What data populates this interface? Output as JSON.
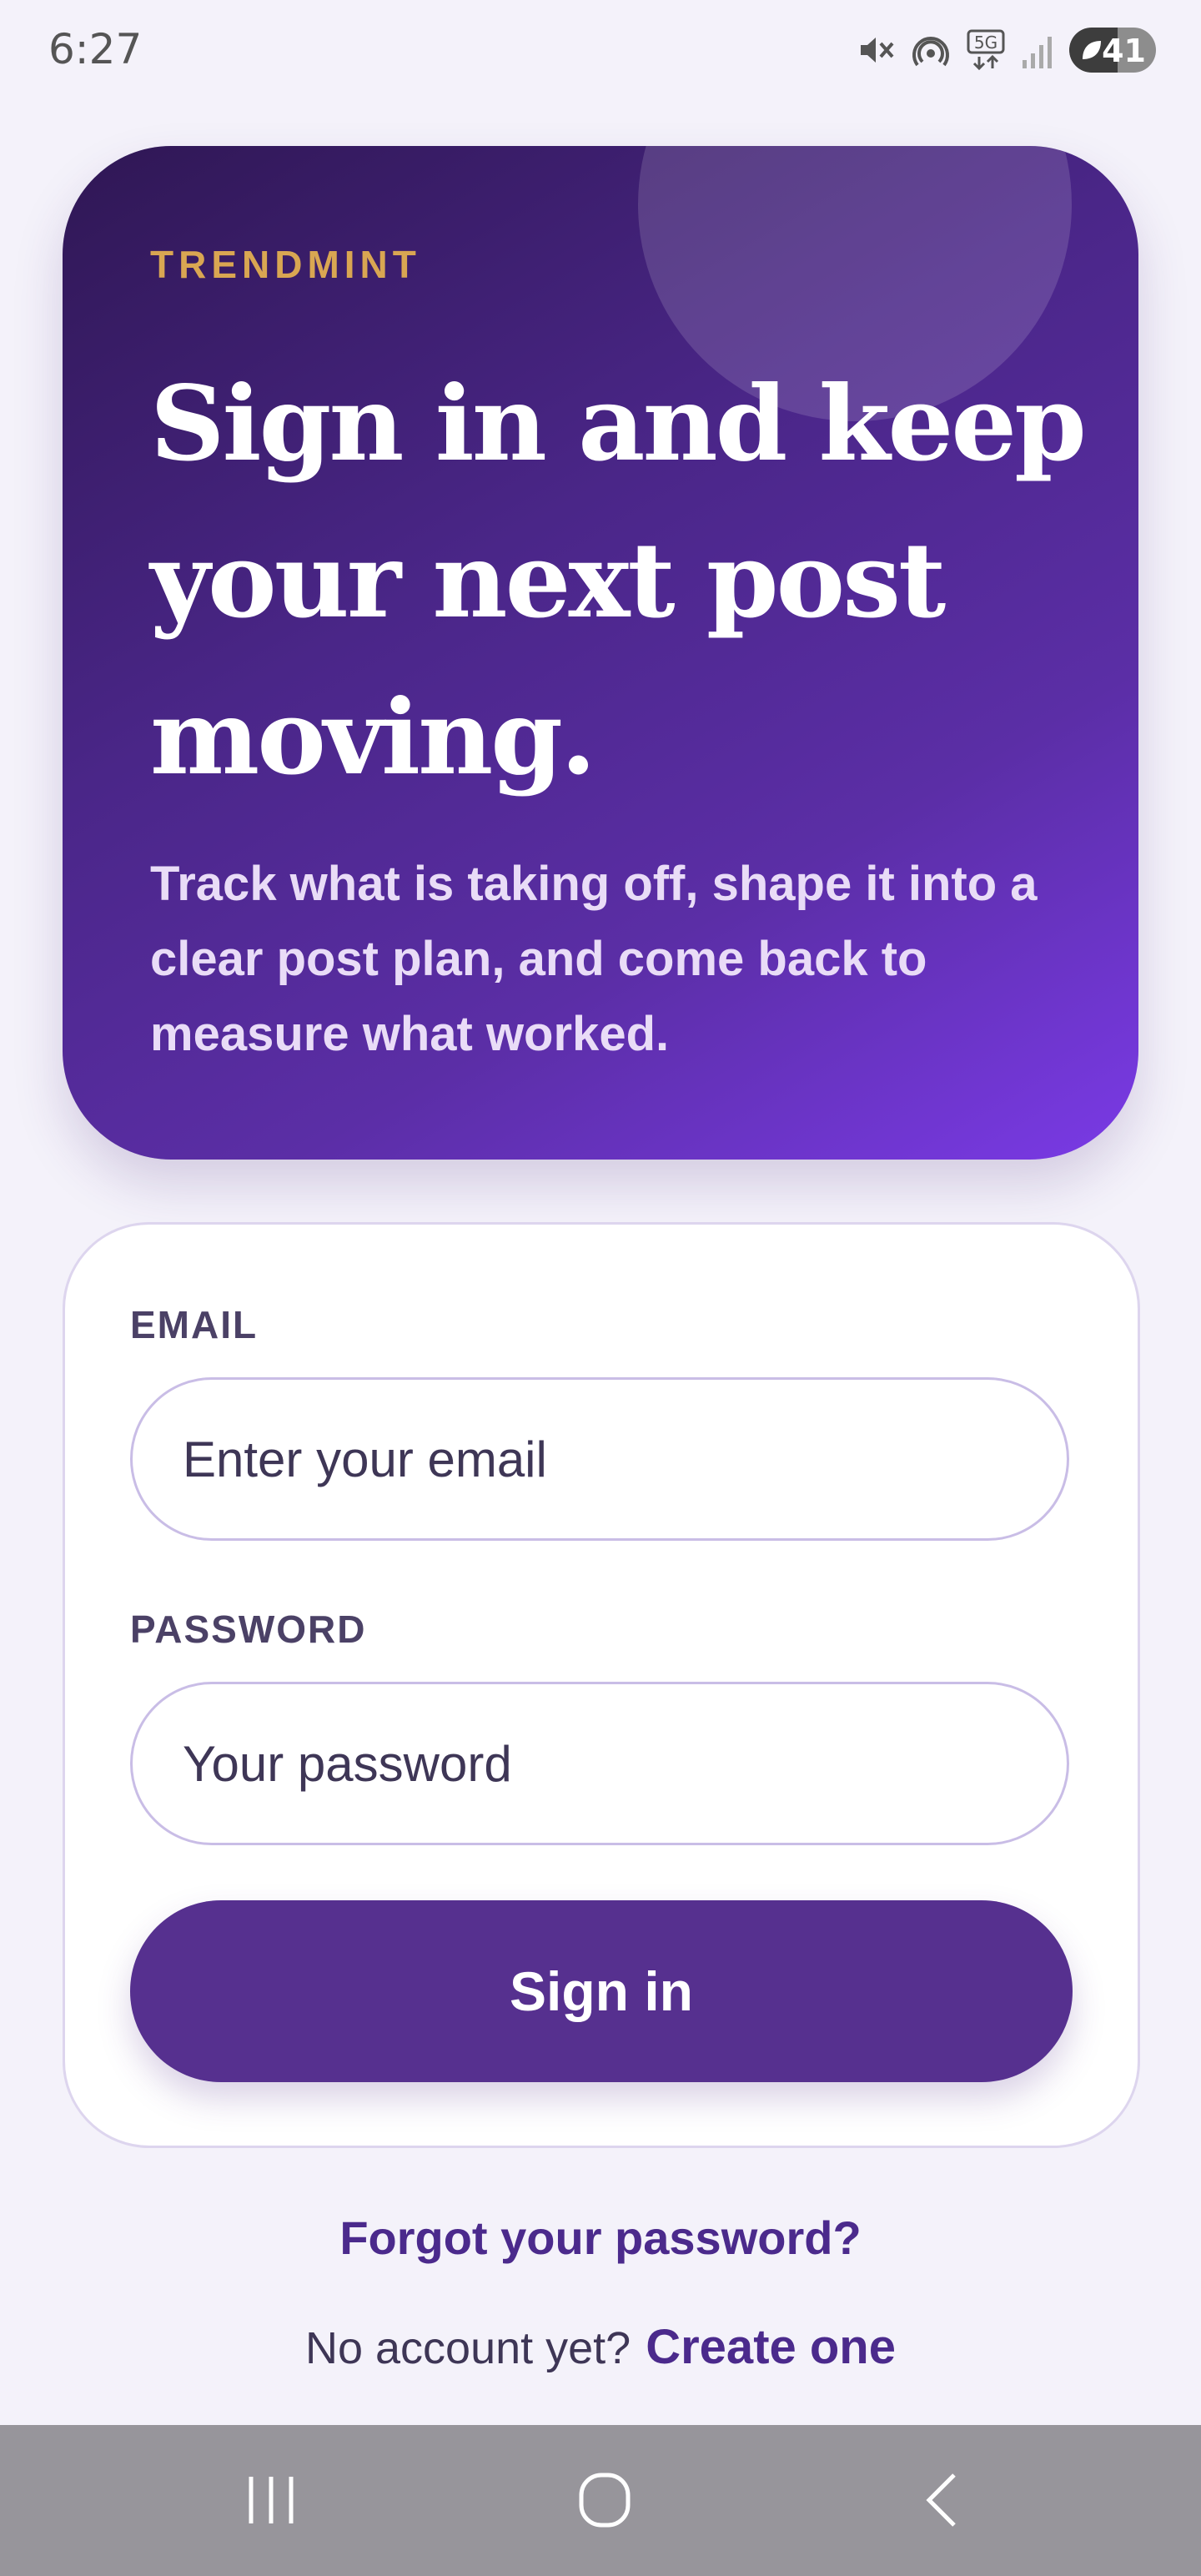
{
  "status_bar": {
    "time": "6:27",
    "battery_level": "41",
    "network": "5G"
  },
  "hero": {
    "brand": "TRENDMINT",
    "title": "Sign in and keep your next post moving.",
    "subtitle": "Track what is taking off, shape it into a clear post plan, and come back to measure what worked."
  },
  "form": {
    "email_label": "EMAIL",
    "email_placeholder": "Enter your email",
    "email_value": "",
    "password_label": "PASSWORD",
    "password_placeholder": "Your password",
    "password_value": "",
    "submit_label": "Sign in"
  },
  "footer": {
    "forgot_label": "Forgot your password?",
    "no_account_text": "No account yet?",
    "create_label": "Create one"
  },
  "nav_bar": {
    "icons": [
      "recent-apps-icon",
      "home-icon",
      "back-icon"
    ]
  },
  "colors": {
    "accent": "#56308f",
    "brand_gold": "#d9a652",
    "link": "#4b2a8c",
    "background": "#f4f2fa"
  }
}
